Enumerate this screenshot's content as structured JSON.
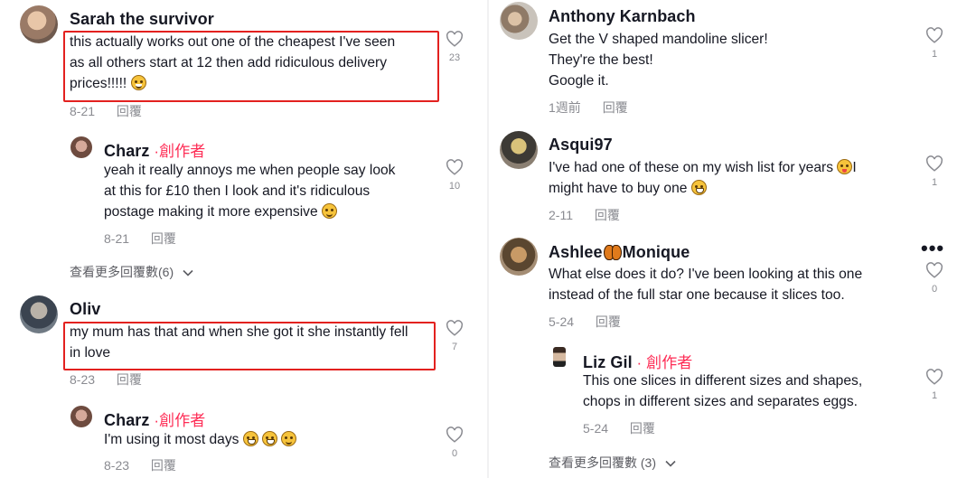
{
  "left_column": {
    "comments": [
      {
        "name": "Sarah the survivor",
        "creator_tag": "",
        "lines": [
          "this actually works out one of the cheapest I've seen",
          "as all others start at 12 then add ridiculous delivery",
          "prices!!!!! "
        ],
        "date": "8-21",
        "reply_label": "回覆",
        "likes": "23"
      },
      {
        "name": "Charz",
        "creator_tag": " ·創作者",
        "lines": [
          "yeah it really annoys me when people say look",
          "at this for £10 then I look and it's ridiculous",
          "postage making it more expensive "
        ],
        "date": "8-21",
        "reply_label": "回覆",
        "likes": "10"
      },
      {
        "name": "Oliv",
        "creator_tag": "",
        "lines": [
          "my mum has that and when she got it she instantly fell",
          "in love"
        ],
        "date": "8-23",
        "reply_label": "回覆",
        "likes": "7"
      },
      {
        "name": "Charz",
        "creator_tag": " ·創作者",
        "lines": [
          "I'm using it most days "
        ],
        "date": "8-23",
        "reply_label": "回覆",
        "likes": "0"
      }
    ],
    "view_more": "查看更多回覆數(6)"
  },
  "right_column": {
    "comments": [
      {
        "name": "Anthony Karnbach",
        "creator_tag": "",
        "lines": [
          "Get the V shaped mandoline slicer!",
          "They're the best!",
          "Google it."
        ],
        "date": "1週前",
        "reply_label": "回覆",
        "likes": "1"
      },
      {
        "name": "Asqui97",
        "creator_tag": "",
        "lines": [
          "I've had one of these on my wish list for years ",
          "might have to buy one "
        ],
        "line_tail": "I",
        "date": "2-11",
        "reply_label": "回覆",
        "likes": "1"
      },
      {
        "name_part1": "Ashlee",
        "name_part2": "Monique",
        "lines": [
          "What else does it do? I've been looking at this one",
          "instead of the full star one because it slices too."
        ],
        "date": "5-24",
        "reply_label": "回覆",
        "likes": "0"
      },
      {
        "name": "Liz Gil",
        "creator_tag": " · 創作者",
        "lines": [
          "This one slices in different sizes and shapes,",
          "chops in different sizes and separates eggs."
        ],
        "date": "5-24",
        "reply_label": "回覆",
        "likes": "1"
      }
    ],
    "more_options": "•••",
    "view_more": "查看更多回覆數 (3)"
  },
  "colors": {
    "creator_tag": "#fe2c55",
    "highlight_box": "#e3211f",
    "meta_text": "#8a8b91"
  }
}
